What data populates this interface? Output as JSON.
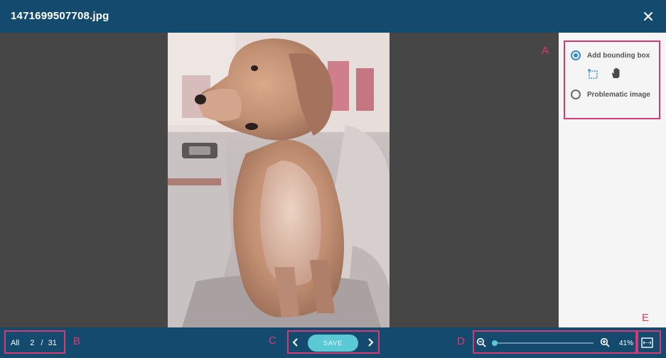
{
  "header": {
    "title": "1471699507708.jpg"
  },
  "image": {
    "subject": "golden retriever sitting in car seat"
  },
  "panel": {
    "options": [
      {
        "label": "Add bounding box",
        "selected": true
      },
      {
        "label": "Problematic image",
        "selected": false
      }
    ],
    "tools": [
      "bounding-box-tool-icon",
      "hand-pan-icon"
    ]
  },
  "footer": {
    "filter_label": "All",
    "current": "2",
    "separator": "/",
    "total": "31",
    "save_label": "SAVE",
    "zoom_percent": "41%",
    "zoom_level": 0.41,
    "slider_fraction": 0.02
  },
  "annotations": {
    "a": "A",
    "b": "B",
    "c": "C",
    "d": "D",
    "e": "E"
  },
  "colors": {
    "header": "#154a6f",
    "stage": "#464646",
    "accent": "#5bc8d6",
    "highlight": "#d63a73",
    "radio": "#3a8fc2"
  }
}
